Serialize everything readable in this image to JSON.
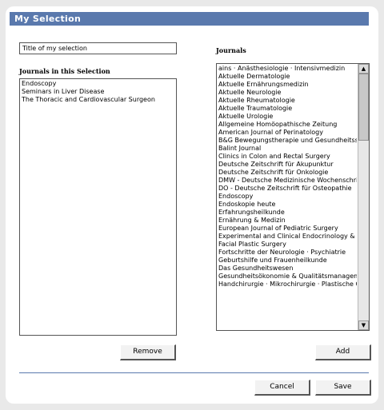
{
  "window": {
    "title": "My Selection"
  },
  "selection": {
    "title_value": "Title of my selection"
  },
  "left_panel": {
    "label": "Journals in this Selection",
    "items": [
      "Endoscopy",
      "Seminars in Liver Disease",
      "The Thoracic and Cardiovascular Surgeon"
    ]
  },
  "right_panel": {
    "label": "Journals",
    "items": [
      "ains · Anästhesiologie · Intensivmedizin",
      "Aktuelle Dermatologie",
      "Aktuelle Ernährungsmedizin",
      "Aktuelle Neurologie",
      "Aktuelle Rheumatologie",
      "Aktuelle Traumatologie",
      "Aktuelle Urologie",
      "Allgemeine Homöopathische Zeitung",
      "American Journal of Perinatology",
      "B&G Bewegungstherapie und Gesundheitssport",
      "Balint Journal",
      "Clinics in Colon and Rectal Surgery",
      "Deutsche Zeitschrift für Akupunktur",
      "Deutsche Zeitschrift für Onkologie",
      "DMW - Deutsche Medizinische Wochenschrift",
      "DO - Deutsche Zeitschrift für Osteopathie",
      "Endoscopy",
      "Endoskopie heute",
      "Erfahrungsheilkunde",
      "Ernährung & Medizin",
      "European Journal of Pediatric Surgery",
      "Experimental and Clinical Endocrinology & Diabetes",
      "Facial Plastic Surgery",
      "Fortschritte der Neurologie · Psychiatrie",
      "Geburtshilfe und Frauenheilkunde",
      "Das Gesundheitswesen",
      "Gesundheitsökonomie & Qualitätsmanagement",
      "Handchirurgie · Mikrochirurgie · Plastische Chirurgie"
    ]
  },
  "buttons": {
    "remove": "Remove",
    "add": "Add",
    "cancel": "Cancel",
    "save": "Save"
  },
  "icons": {
    "scroll_up": "arrow-up-icon",
    "scroll_down": "arrow-down-icon"
  },
  "colors": {
    "titlebar": "#5a79ad",
    "background": "#e9e9e9"
  }
}
